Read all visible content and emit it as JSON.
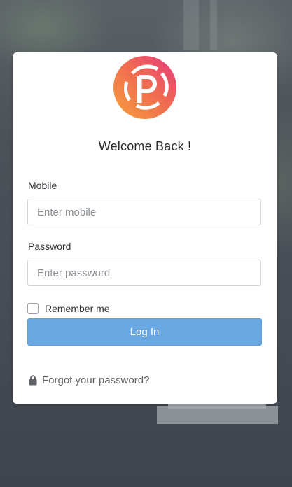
{
  "brand": {
    "logo_icon": "p-logo-icon",
    "gradient_start": "#f28a3c",
    "gradient_end": "#e8437a"
  },
  "form": {
    "title": "Welcome Back !",
    "mobile": {
      "label": "Mobile",
      "placeholder": "Enter mobile",
      "value": ""
    },
    "password": {
      "label": "Password",
      "placeholder": "Enter password",
      "value": ""
    },
    "remember": {
      "label": "Remember me",
      "checked": false
    },
    "login_button": "Log In",
    "forgot": {
      "icon": "lock-icon",
      "text": "Forgot your password?"
    }
  },
  "colors": {
    "accent": "#6aa8e4",
    "card": "#ffffff"
  }
}
